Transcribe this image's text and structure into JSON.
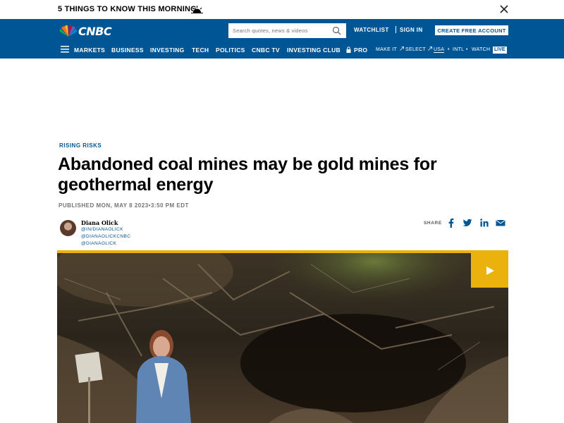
{
  "banner": {
    "text": "5 THINGS TO KNOW THIS MORNING",
    "sunrise_icon": "sunrise-icon",
    "close_icon": "close-icon"
  },
  "header": {
    "logo_text": "CNBC",
    "search_placeholder": "Search quotes, news & videos",
    "watchlist": "WATCHLIST",
    "sign_in": "SIGN IN",
    "create_account": "CREATE FREE ACCOUNT",
    "brand_color": "#005594"
  },
  "nav": {
    "items": [
      "MARKETS",
      "BUSINESS",
      "INVESTING",
      "TECH",
      "POLITICS",
      "CNBC TV",
      "INVESTING CLUB",
      "PRO"
    ],
    "make_it": "MAKE IT",
    "select": "SELECT",
    "usa": "USA",
    "intl": "INTL",
    "watch": "WATCH",
    "live": "LIVE"
  },
  "article": {
    "kicker": "RISING RISKS",
    "headline_line1": "Abandoned coal mines may be gold mines for",
    "headline_line2": "geothermal energy",
    "published": "PUBLISHED MON, MAY 8 2023•3:50 PM EDT",
    "author": {
      "name": "Diana Olick",
      "handles": [
        "@IN/DIANAOLICK",
        "@DIANAOLICKCNBC",
        "@DIANAOLICK"
      ]
    },
    "share_label": "SHARE"
  },
  "video": {
    "accent_color": "#ebb20d",
    "play_icon": "play-icon"
  }
}
